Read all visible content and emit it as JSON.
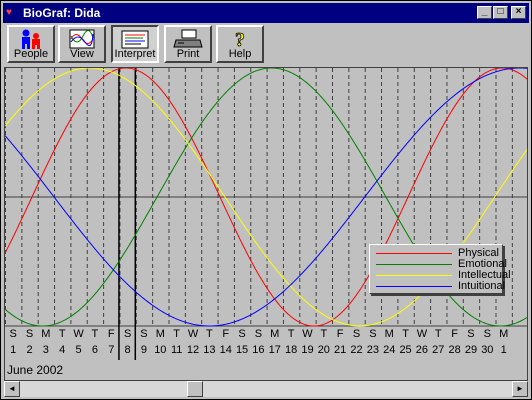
{
  "window": {
    "title": "BioGraf: Dida",
    "controls": [
      "_",
      "□",
      "×"
    ]
  },
  "toolbar": {
    "buttons": [
      {
        "id": "people",
        "label": "People",
        "icon": "people-icon"
      },
      {
        "id": "view",
        "label": "View",
        "icon": "wave-view-icon"
      },
      {
        "id": "interpret",
        "label": "Interpret",
        "icon": "interpret-icon"
      },
      {
        "id": "print",
        "label": "Print",
        "icon": "printer-icon"
      },
      {
        "id": "help",
        "label": "Help",
        "icon": "help-icon"
      }
    ]
  },
  "calendar": {
    "month_label": "June 2002",
    "days": [
      {
        "dow": "S",
        "n": "1"
      },
      {
        "dow": "S",
        "n": "2"
      },
      {
        "dow": "M",
        "n": "3"
      },
      {
        "dow": "T",
        "n": "4"
      },
      {
        "dow": "W",
        "n": "5"
      },
      {
        "dow": "T",
        "n": "6"
      },
      {
        "dow": "F",
        "n": "7"
      },
      {
        "dow": "S",
        "n": "8"
      },
      {
        "dow": "S",
        "n": "9"
      },
      {
        "dow": "M",
        "n": "10"
      },
      {
        "dow": "T",
        "n": "11"
      },
      {
        "dow": "W",
        "n": "12"
      },
      {
        "dow": "T",
        "n": "13"
      },
      {
        "dow": "F",
        "n": "14"
      },
      {
        "dow": "S",
        "n": "15"
      },
      {
        "dow": "S",
        "n": "16"
      },
      {
        "dow": "M",
        "n": "17"
      },
      {
        "dow": "T",
        "n": "18"
      },
      {
        "dow": "W",
        "n": "19"
      },
      {
        "dow": "T",
        "n": "20"
      },
      {
        "dow": "F",
        "n": "21"
      },
      {
        "dow": "S",
        "n": "22"
      },
      {
        "dow": "S",
        "n": "23"
      },
      {
        "dow": "M",
        "n": "24"
      },
      {
        "dow": "T",
        "n": "25"
      },
      {
        "dow": "W",
        "n": "26"
      },
      {
        "dow": "T",
        "n": "27"
      },
      {
        "dow": "F",
        "n": "28"
      },
      {
        "dow": "S",
        "n": "29"
      },
      {
        "dow": "S",
        "n": "30"
      },
      {
        "dow": "M",
        "n": "1"
      }
    ],
    "selected_day": "8"
  },
  "chart_data": {
    "type": "line",
    "x_range": [
      0,
      31
    ],
    "y_range": [
      -1,
      1
    ],
    "series": [
      {
        "name": "Physical",
        "color": "#ff0000",
        "period": 23,
        "peak_day": 7.4
      },
      {
        "name": "Emotional",
        "color": "#008000",
        "period": 28,
        "peak_day": 16.3
      },
      {
        "name": "Intellectual",
        "color": "#ffff00",
        "period": 33,
        "peak_day": 5.2
      },
      {
        "name": "Intuitional",
        "color": "#0000ff",
        "period": 38,
        "peak_day": -6.5
      }
    ]
  },
  "legend": {
    "position": "right",
    "entries": [
      "Physical",
      "Emotional",
      "Intellectual",
      "Intuitional"
    ]
  },
  "scrollbar": {
    "left_arrow": "◄",
    "right_arrow": "►",
    "position_fraction": 0.35
  }
}
